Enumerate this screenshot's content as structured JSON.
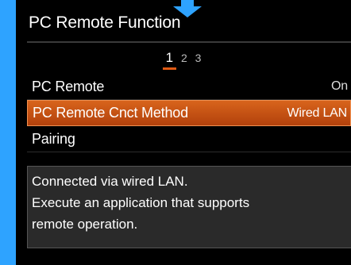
{
  "title": "PC Remote Function",
  "pages": [
    "1",
    "2",
    "3"
  ],
  "menu": {
    "items": [
      {
        "label": "PC Remote",
        "value": "On"
      },
      {
        "label": "PC Remote Cnct Method",
        "value": "Wired LAN"
      },
      {
        "label": "Pairing",
        "value": ""
      }
    ]
  },
  "info": {
    "lines": [
      "Connected via wired LAN.",
      "Execute an application that supports",
      "remote operation."
    ]
  },
  "colors": {
    "accent": "#e05a14",
    "frame": "#2ea3ff",
    "selected_row": "#c4521a"
  },
  "icons": {
    "pointer": "down-arrow-icon"
  }
}
